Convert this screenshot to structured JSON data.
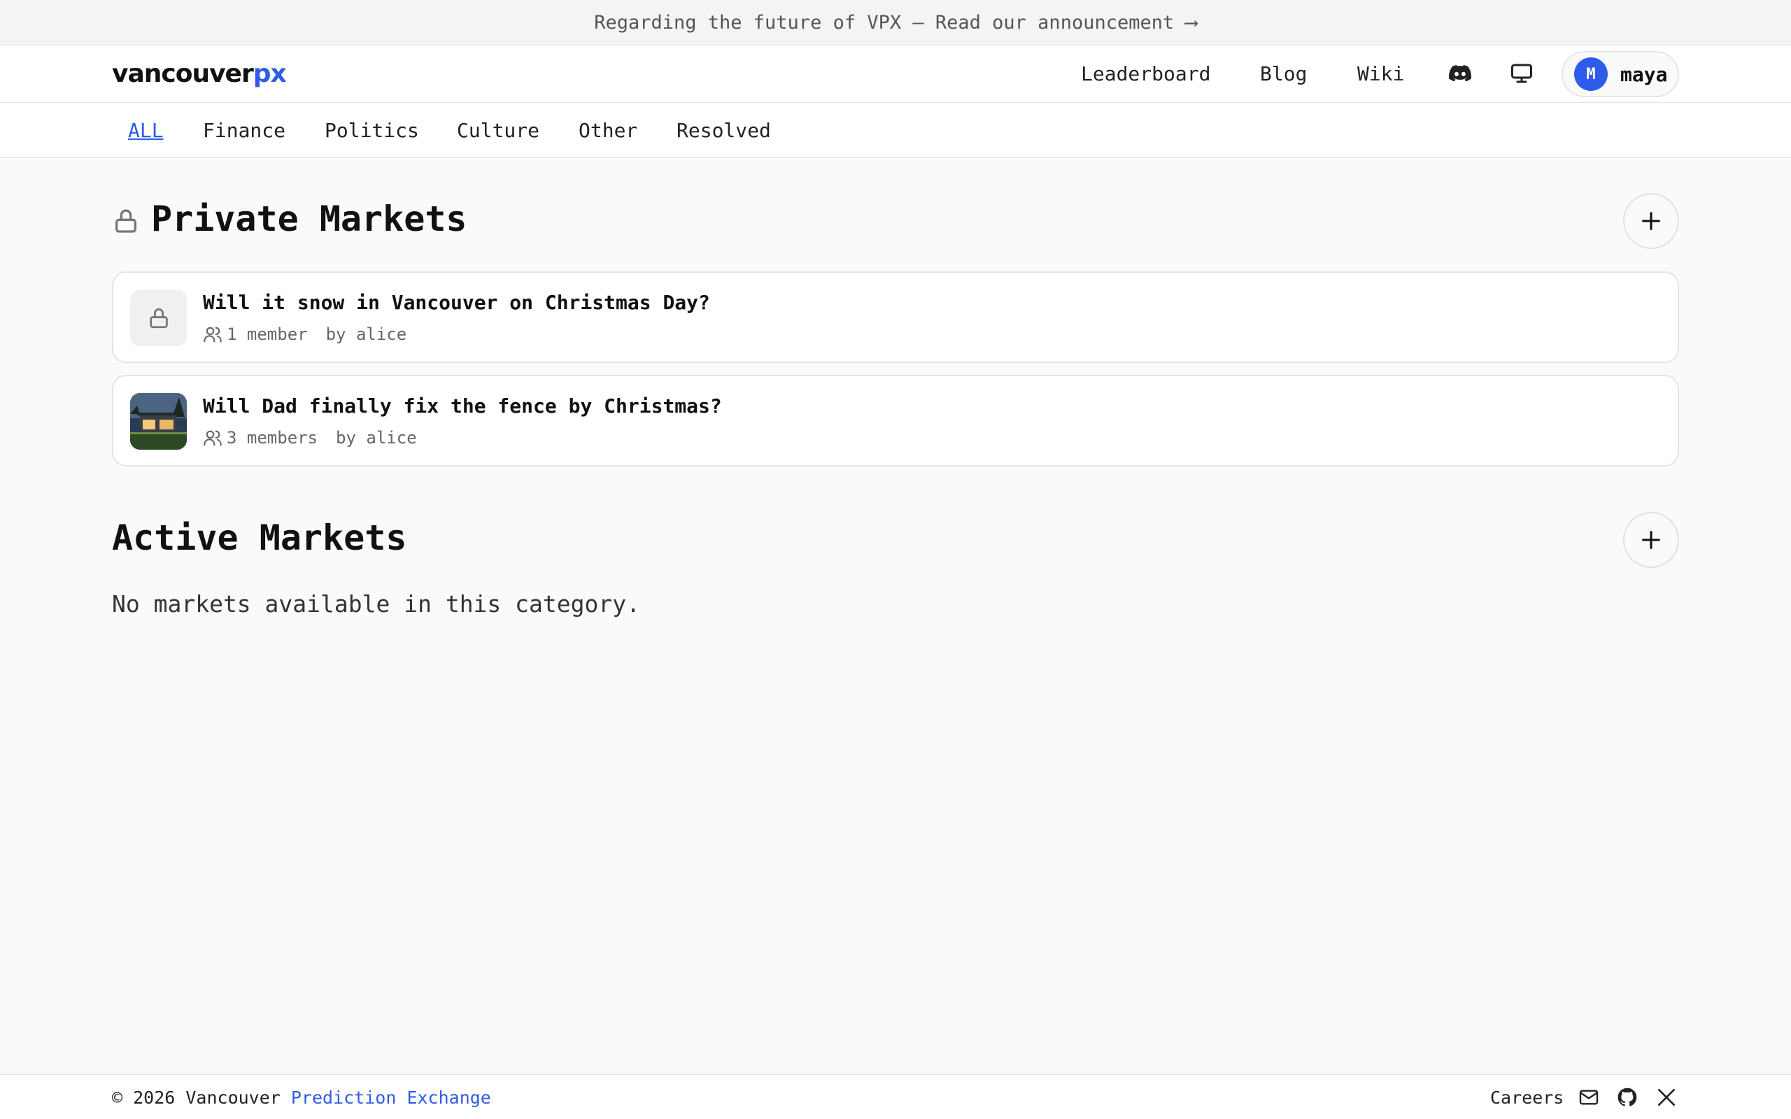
{
  "banner": {
    "text": "Regarding the future of VPX — Read our announcement ⟶"
  },
  "header": {
    "logo_main": "vancouver",
    "logo_accent": "px",
    "nav": [
      "Leaderboard",
      "Blog",
      "Wiki"
    ],
    "user": {
      "initial": "M",
      "name": "maya"
    }
  },
  "tabs": [
    "ALL",
    "Finance",
    "Politics",
    "Culture",
    "Other",
    "Resolved"
  ],
  "private_markets": {
    "title": "Private Markets",
    "cards": [
      {
        "title": "Will it snow in Vancouver on Christmas Day?",
        "members": "1 member",
        "author": "by alice"
      },
      {
        "title": "Will Dad finally fix the fence by Christmas?",
        "members": "3 members",
        "author": "by alice"
      }
    ]
  },
  "active_markets": {
    "title": "Active Markets",
    "empty": "No markets available in this category."
  },
  "footer": {
    "copyright_prefix": "© 2026 Vancouver ",
    "copyright_link": "Prediction Exchange",
    "careers": "Careers"
  },
  "colors": {
    "accent": "#2f5bea",
    "background": "#fafafa",
    "border": "#e4e4e4"
  },
  "icons": [
    "discord-icon",
    "monitor-icon",
    "lock-icon",
    "plus-icon",
    "users-icon",
    "mail-icon",
    "github-icon",
    "x-icon"
  ]
}
